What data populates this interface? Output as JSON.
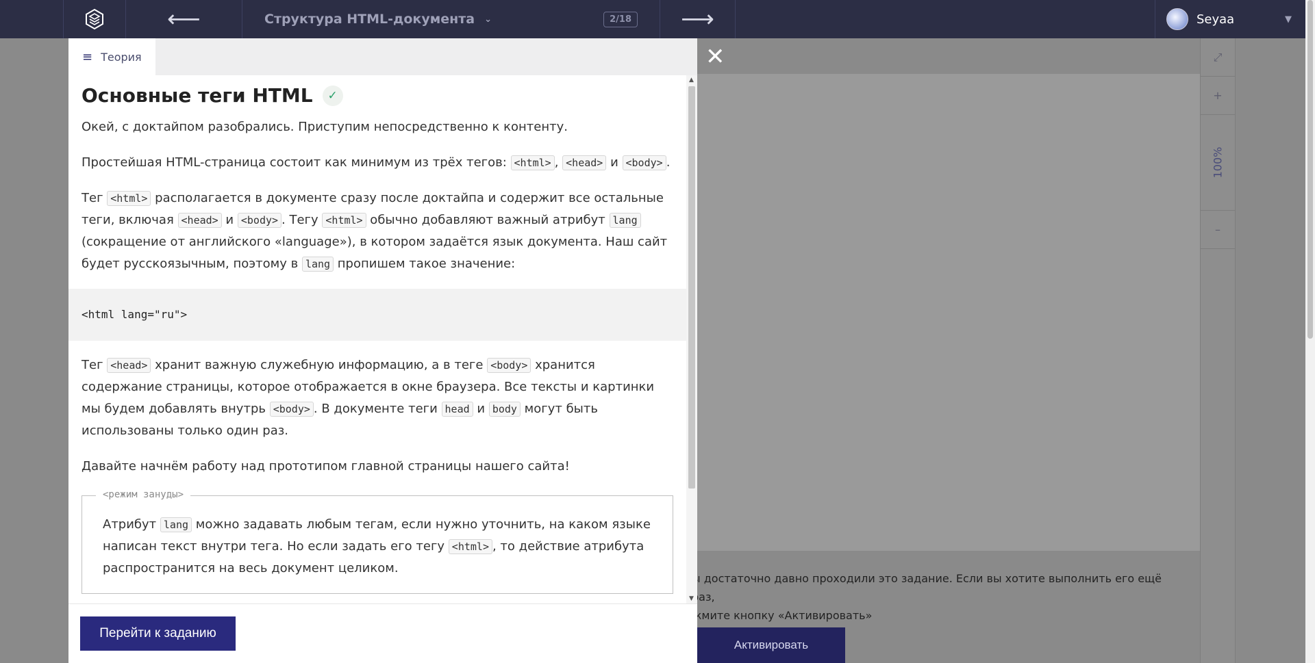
{
  "topbar": {
    "title": "Структура HTML-документа",
    "counter": "2/18",
    "back_icon": "arrow-left-icon",
    "next_icon": "arrow-right-icon",
    "user_name": "Seyaa"
  },
  "theory": {
    "tab_label": "Теория",
    "heading": "Основные теги HTML",
    "p1": "Окей, с доктайпом разобрались. Приступим непосредственно к контенту.",
    "p2": {
      "t1": "Простейшая HTML-страница состоит как минимум из трёх тегов: ",
      "c1": "<html>",
      "t2": ", ",
      "c2": "<head>",
      "t3": " и ",
      "c3": "<body>",
      "t4": "."
    },
    "p3": {
      "t1": "Тег ",
      "c1": "<html>",
      "t2": " располагается в документе сразу после доктайпа и содержит все остальные теги, включая ",
      "c2": "<head>",
      "t3": " и ",
      "c3": "<body>",
      "t4": ". Тегу ",
      "c4": "<html>",
      "t5": " обычно добавляют важный атрибут ",
      "c5": "lang",
      "t6": " (сокращение от английского «language»), в котором задаётся язык документа. Наш сайт будет русскоязычным, поэтому в ",
      "c6": "lang",
      "t7": " пропишем такое значение:"
    },
    "code": "<html lang=\"ru\">",
    "p4": {
      "t1": "Тег ",
      "c1": "<head>",
      "t2": " хранит важную служебную информацию, а в теге ",
      "c2": "<body>",
      "t3": " хранится содержание страницы, которое отображается в окне браузера. Все тексты и картинки мы будем добавлять внутрь ",
      "c3": "<body>",
      "t4": ". В документе теги ",
      "c4": "head",
      "t5": " и ",
      "c5": "body",
      "t6": " могут быть использованы только один раз."
    },
    "p5": "Давайте начнём работу над прототипом главной страницы нашего сайта!",
    "aside": {
      "label": "<режим зануды>",
      "t1": "Атрибут ",
      "c1": "lang",
      "t2": " можно задавать любым тегам, если нужно уточнить, на каком языке написан текст внутри тега. Но если задать его тегу ",
      "c2": "<html>",
      "t3": ", то действие атрибута распространится на весь документ целиком."
    },
    "go_button": "Перейти к заданию"
  },
  "task": {
    "note_line1": "ы достаточно давно проходили это задание. Если вы хотите выполнить его ещё раз,",
    "note_line2": "жмите кнопку «Активировать»",
    "activate_button": "Активировать"
  },
  "zoom": {
    "expand_icon": "expand-icon",
    "plus": "+",
    "level": "100%",
    "minus": "–"
  },
  "colors": {
    "topbar": "#2c2e45",
    "primary_button": "#2a2a7e",
    "check": "#2aa06a"
  }
}
